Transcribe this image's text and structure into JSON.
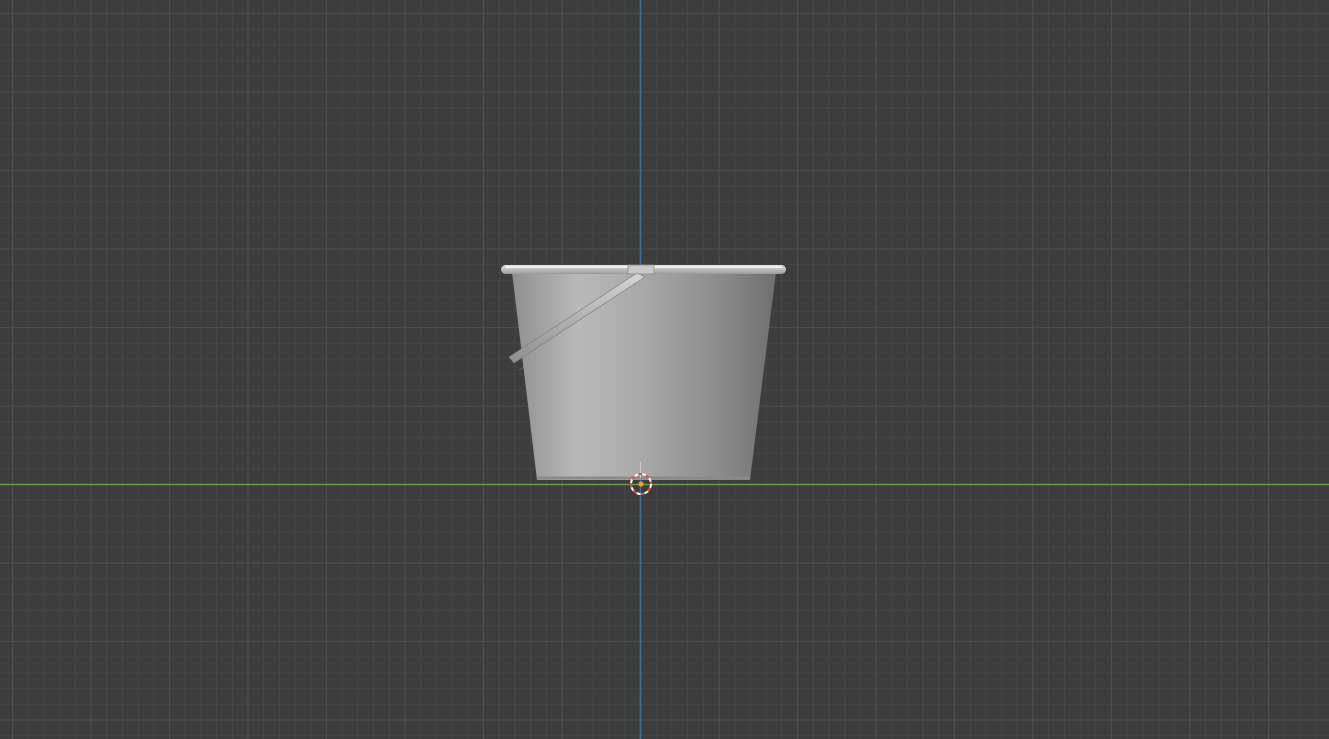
{
  "viewport": {
    "view": "front-orthographic",
    "grid": true,
    "colors": {
      "background": "#3d3d3d",
      "grid_minor": "#464646",
      "grid_major": "#4e4e4e",
      "axis_x": "#6b9a42",
      "axis_z": "#3d6d99",
      "bucket_light": "#c3c3c3",
      "bucket_mid": "#9b9b9b",
      "bucket_dark": "#6f6f6f",
      "handle": "#bdbdbd",
      "cursor_ring_red": "#d9534f",
      "cursor_ring_white": "#ffffff",
      "origin_dot": "#e8a13a"
    },
    "objects": [
      {
        "name": "bucket",
        "parts": [
          "bucket-body",
          "bucket-rim",
          "bucket-handle"
        ]
      }
    ],
    "overlays": [
      "3d-cursor",
      "object-origin"
    ]
  }
}
